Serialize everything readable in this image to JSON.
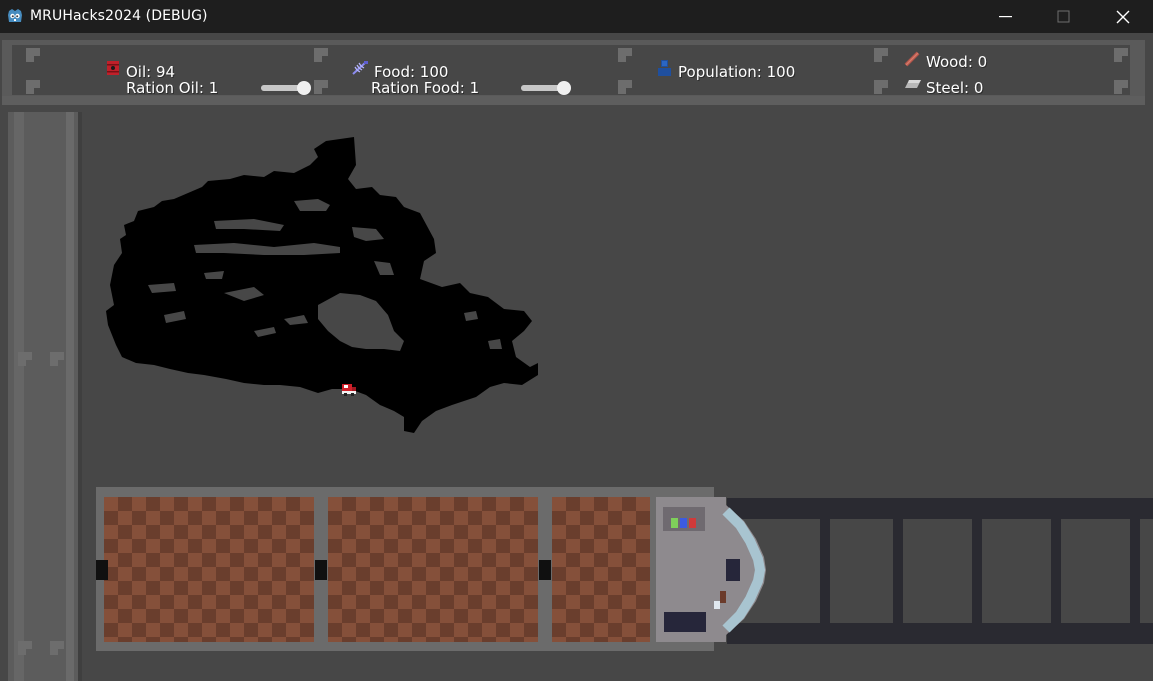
{
  "window": {
    "title": "MRUHacks2024 (DEBUG)",
    "icon": "godot-engine-icon",
    "controls": [
      "minimize-icon",
      "maximize-icon",
      "close-icon"
    ]
  },
  "resources": {
    "oil": {
      "label": "Oil: 94",
      "icon": "oil-barrel-icon",
      "icon_color": "#c0202a"
    },
    "ration_oil": {
      "label": "Ration Oil: 1",
      "slider_value": 0.85
    },
    "food": {
      "label": "Food: 100",
      "icon": "fish-skeleton-icon",
      "icon_color": "#8c8cf0"
    },
    "ration_food": {
      "label": "Ration Food: 1",
      "slider_value": 0.85
    },
    "population": {
      "label": "Population: 100",
      "icon": "person-icon",
      "icon_color": "#1f4f9e"
    },
    "wood": {
      "label": "Wood: 0",
      "icon": "plank-icon",
      "icon_color": "#b3564b"
    },
    "steel": {
      "label": "Steel: 0",
      "icon": "ingot-icon",
      "icon_color": "#b8b8b8"
    }
  },
  "map": {
    "region": "canada-map",
    "map_color": "#000000",
    "marker": "train-location-icon"
  },
  "train": {
    "cars": [
      "cargo-car",
      "cargo-car",
      "cargo-car"
    ],
    "car_colors": [
      "#85503a",
      "#6a3e2d"
    ],
    "engine_lights": [
      "#7fd05a",
      "#3c5be0",
      "#d03a3a"
    ]
  }
}
